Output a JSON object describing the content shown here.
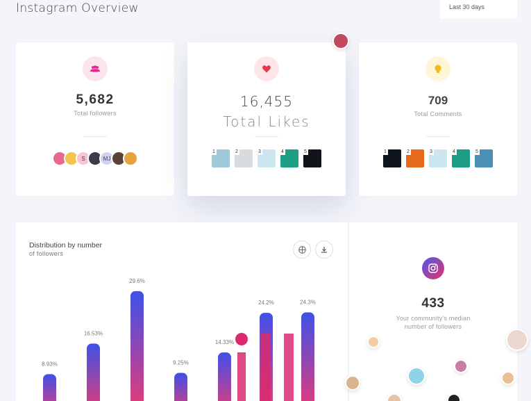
{
  "header": {
    "title": "Instagram Overview",
    "period": "Last 30 days"
  },
  "followers_card": {
    "value": "5,682",
    "label": "Total followers",
    "icon": "people-icon",
    "accent": "#e0288b",
    "avatars": [
      {
        "initials": "",
        "color": "#e86a8f"
      },
      {
        "initials": "",
        "color": "#f3c44a"
      },
      {
        "initials": "S",
        "color": "#f8c3d3"
      },
      {
        "initials": "",
        "color": "#3a3a48"
      },
      {
        "initials": "MJ",
        "color": "#cfd3f2"
      },
      {
        "initials": "",
        "color": "#5a4336"
      },
      {
        "initials": "",
        "color": "#e6a23c"
      }
    ]
  },
  "likes_card": {
    "value": "16,455",
    "label": "Total Likes",
    "icon": "heart-icon",
    "accent": "#e53950",
    "posts": [
      {
        "rank": "1",
        "color": "#9fc8d8"
      },
      {
        "rank": "2",
        "color": "#d9dcdf"
      },
      {
        "rank": "3",
        "color": "#cbe6ef"
      },
      {
        "rank": "4",
        "color": "#1f9e86"
      },
      {
        "rank": "5",
        "color": "#111418"
      }
    ]
  },
  "comments_card": {
    "value": "709",
    "label": "Total Comments",
    "icon": "lightbulb-icon",
    "accent": "#f5b820",
    "posts": [
      {
        "rank": "1",
        "color": "#10151c"
      },
      {
        "rank": "2",
        "color": "#e56a1c"
      },
      {
        "rank": "3",
        "color": "#cbe6ef"
      },
      {
        "rank": "4",
        "color": "#1f9e86"
      },
      {
        "rank": "5",
        "color": "#4b8fb5"
      }
    ]
  },
  "distribution": {
    "title": "Distribution by number",
    "subtitle": "of followers",
    "gradient_top": "#3f51e8",
    "gradient_bottom": "#f23a6e",
    "marker_color": "#d92a6e"
  },
  "chart_data": {
    "type": "bar",
    "series": [
      {
        "values": [
          8.93,
          16.53,
          29.6,
          9.25,
          14.33,
          24.2,
          24.3
        ],
        "labels": [
          "8.93%",
          "16.53%",
          "29.6%",
          "9.25%",
          "14.33%",
          "24.2%",
          "24.3%"
        ]
      }
    ],
    "ylim": [
      0,
      32
    ],
    "grid": false,
    "legend": false
  },
  "median_card": {
    "value": "433",
    "label_line1": "Your community's median",
    "label_line2": "number of followers",
    "icon": "instagram-icon"
  }
}
